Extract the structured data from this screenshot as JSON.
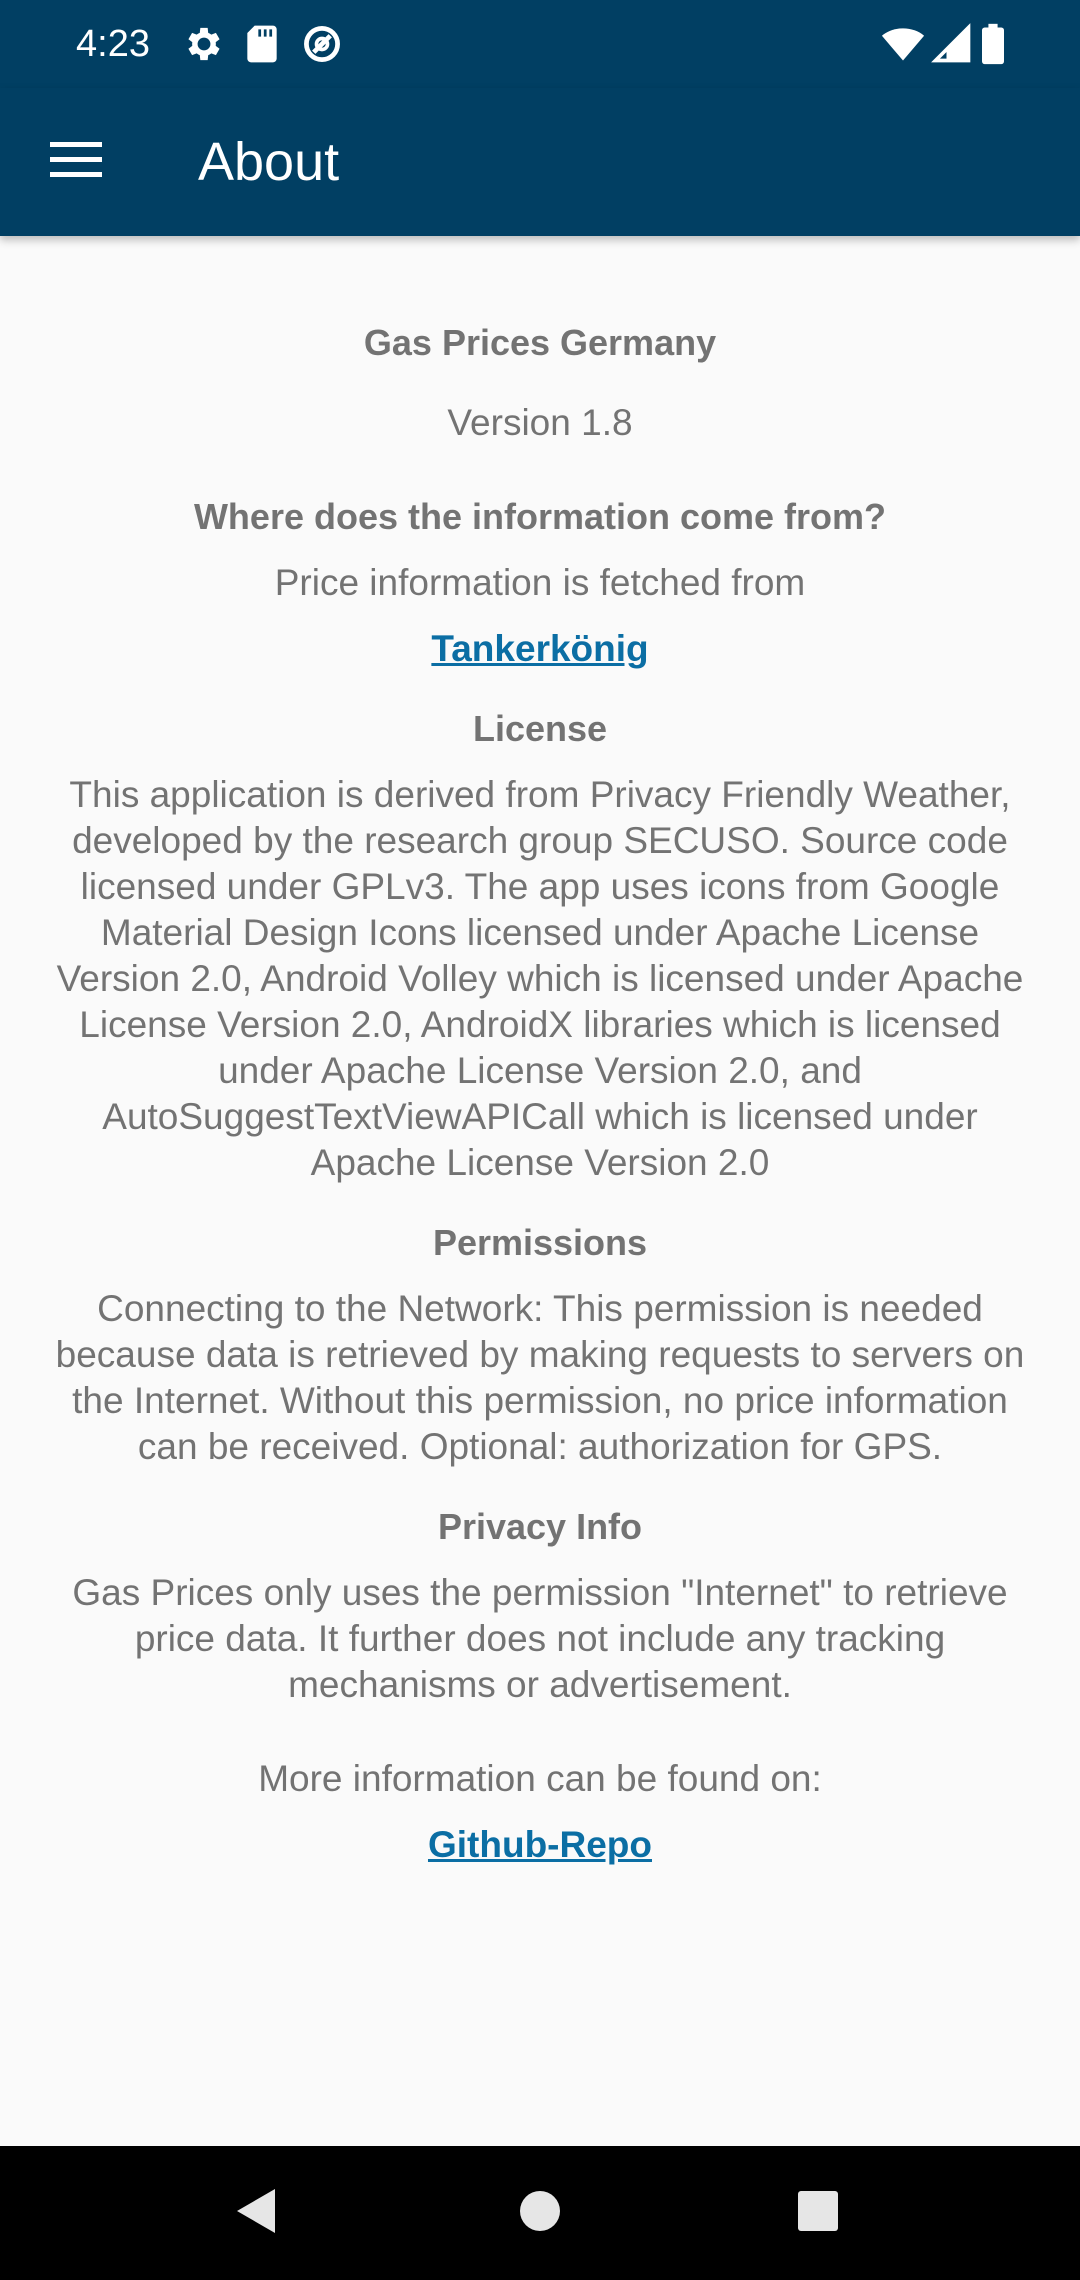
{
  "status_bar": {
    "time": "4:23",
    "left_icons": [
      "settings-gear-icon",
      "sd-card-icon",
      "data-saver-icon"
    ],
    "right_icons": [
      "wifi-icon",
      "cell-signal-icon",
      "battery-icon"
    ]
  },
  "app_bar": {
    "title": "About",
    "menu_icon": "hamburger-menu-icon",
    "background_color": "#013f63"
  },
  "about": {
    "app_name": "Gas Prices Germany",
    "version": "Version 1.8",
    "source_heading": "Where does the information come from?",
    "source_text": "Price information is fetched from",
    "source_link": "Tankerkönig",
    "license_heading": "License",
    "license_text": "This application is derived from Privacy Friendly Weather, developed by the research group SECUSO. Source code licensed under GPLv3. The app uses icons from Google Material Design Icons licensed under Apache License Version 2.0, Android Volley which is licensed under Apache License Version 2.0, AndroidX libraries which is licensed under Apache License Version 2.0, and AutoSuggestTextViewAPICall which is licensed under Apache License Version 2.0",
    "permissions_heading": "Permissions",
    "permissions_text": "Connecting to the Network: This permission is needed because data is retrieved by making requests to servers on the Internet. Without this permission, no price information can be received. Optional: authorization for GPS.",
    "privacy_heading": "Privacy Info",
    "privacy_text": "Gas Prices only uses the permission \"Internet\" to retrieve price data. It further does not include any tracking mechanisms or advertisement.",
    "more_info_text": "More information can be found on:",
    "more_info_link": "Github-Repo",
    "text_color": "#737373",
    "link_color": "#0b6ea4"
  },
  "nav_bar": {
    "back_icon": "back-triangle-icon",
    "home_icon": "home-circle-icon",
    "recents_icon": "recents-square-icon"
  }
}
